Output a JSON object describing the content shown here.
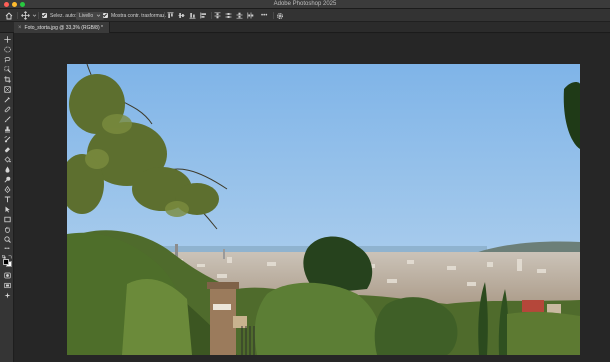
{
  "window": {
    "title": "Adobe Photoshop 2025"
  },
  "options_bar": {
    "auto_select_label": "Selez. auto:",
    "layer_select_value": "Livello",
    "show_transform_label": "Mostra contr. trasformaz.",
    "more_label": "•••"
  },
  "document": {
    "tab_label": "Foto_storta.jpg @ 33,3% (RGB/8) *",
    "close_label": "×"
  },
  "toolbar": {
    "more_label": "•••"
  },
  "image": {
    "description_icon": "photo-panorama"
  },
  "colors": {
    "foreground": "#000000",
    "background": "#ffffff",
    "sky_top": "#7fb4e8",
    "sky_bottom": "#bcd7ee"
  }
}
